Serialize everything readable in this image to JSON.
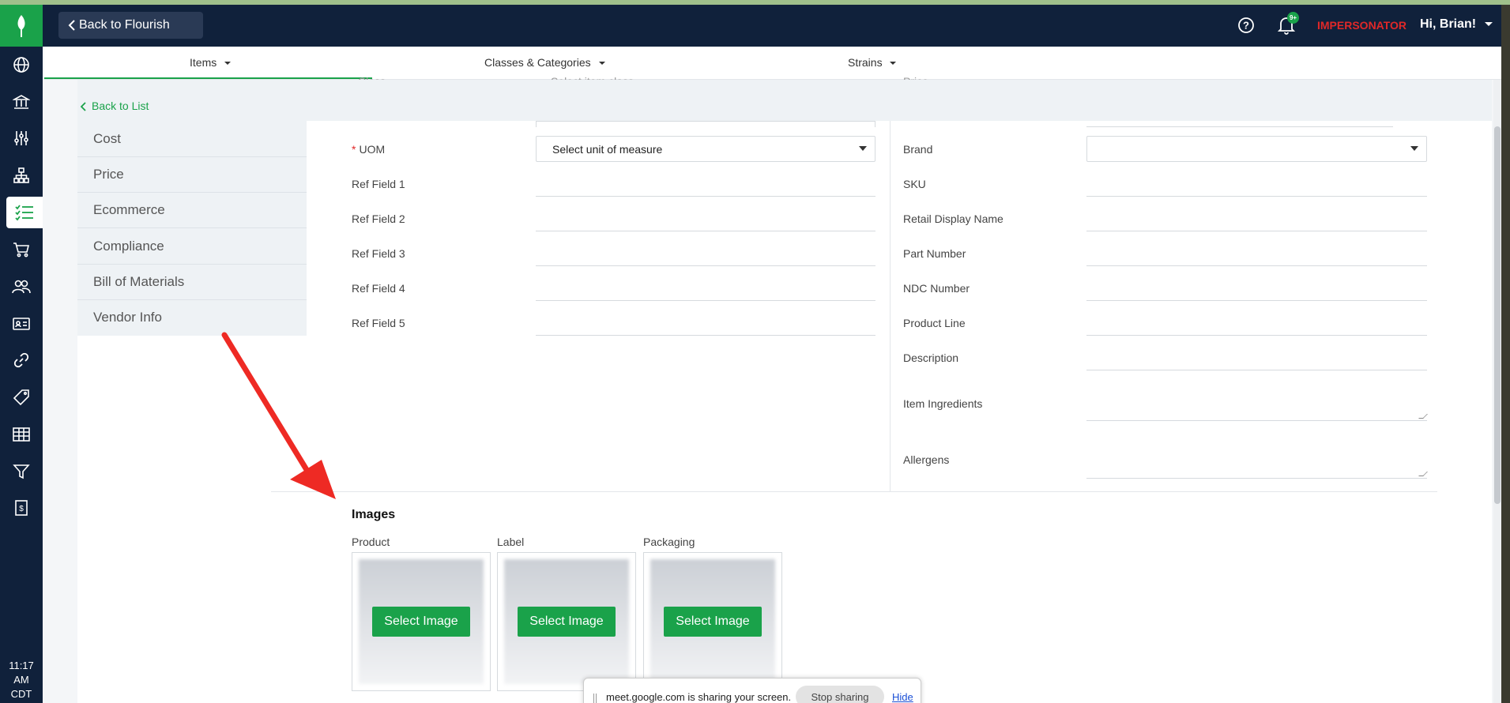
{
  "header": {
    "back_label": "Back to Flourish",
    "impersonator": "IMPERSONATOR",
    "user_greeting": "Hi, Brian!",
    "notification_badge": "9+"
  },
  "tabs": [
    {
      "label": "Items"
    },
    {
      "label": "Classes & Categories"
    },
    {
      "label": "Strains"
    }
  ],
  "nav": {
    "back_to_list": "Back to List",
    "side_items": [
      "Cost",
      "Price",
      "Ecommerce",
      "Compliance",
      "Bill of Materials",
      "Vendor Info"
    ]
  },
  "form": {
    "partial_top_left_label": "Class",
    "partial_top_left_placeholder": "Select item class",
    "partial_top_right_label": "Price",
    "uom": {
      "label": "UOM",
      "placeholder": "Select unit of measure"
    },
    "left_fields": [
      "Ref Field 1",
      "Ref Field 2",
      "Ref Field 3",
      "Ref Field 4",
      "Ref Field 5"
    ],
    "brand_label": "Brand",
    "right_fields": [
      "SKU",
      "Retail Display Name",
      "Part Number",
      "NDC Number",
      "Product Line",
      "Description"
    ],
    "ingredients_label": "Item Ingredients",
    "allergens_label": "Allergens"
  },
  "images": {
    "title": "Images",
    "slots": [
      {
        "label": "Product",
        "button": "Select Image"
      },
      {
        "label": "Label",
        "button": "Select Image"
      },
      {
        "label": "Packaging",
        "button": "Select Image"
      }
    ]
  },
  "clock": {
    "time": "11:17",
    "ampm": "AM",
    "tz": "CDT"
  },
  "share_bar": {
    "message": "meet.google.com is sharing your screen.",
    "stop": "Stop sharing",
    "hide": "Hide"
  },
  "colors": {
    "accent": "#1aa24a",
    "header_bg": "#10213b",
    "danger": "#e02828"
  }
}
